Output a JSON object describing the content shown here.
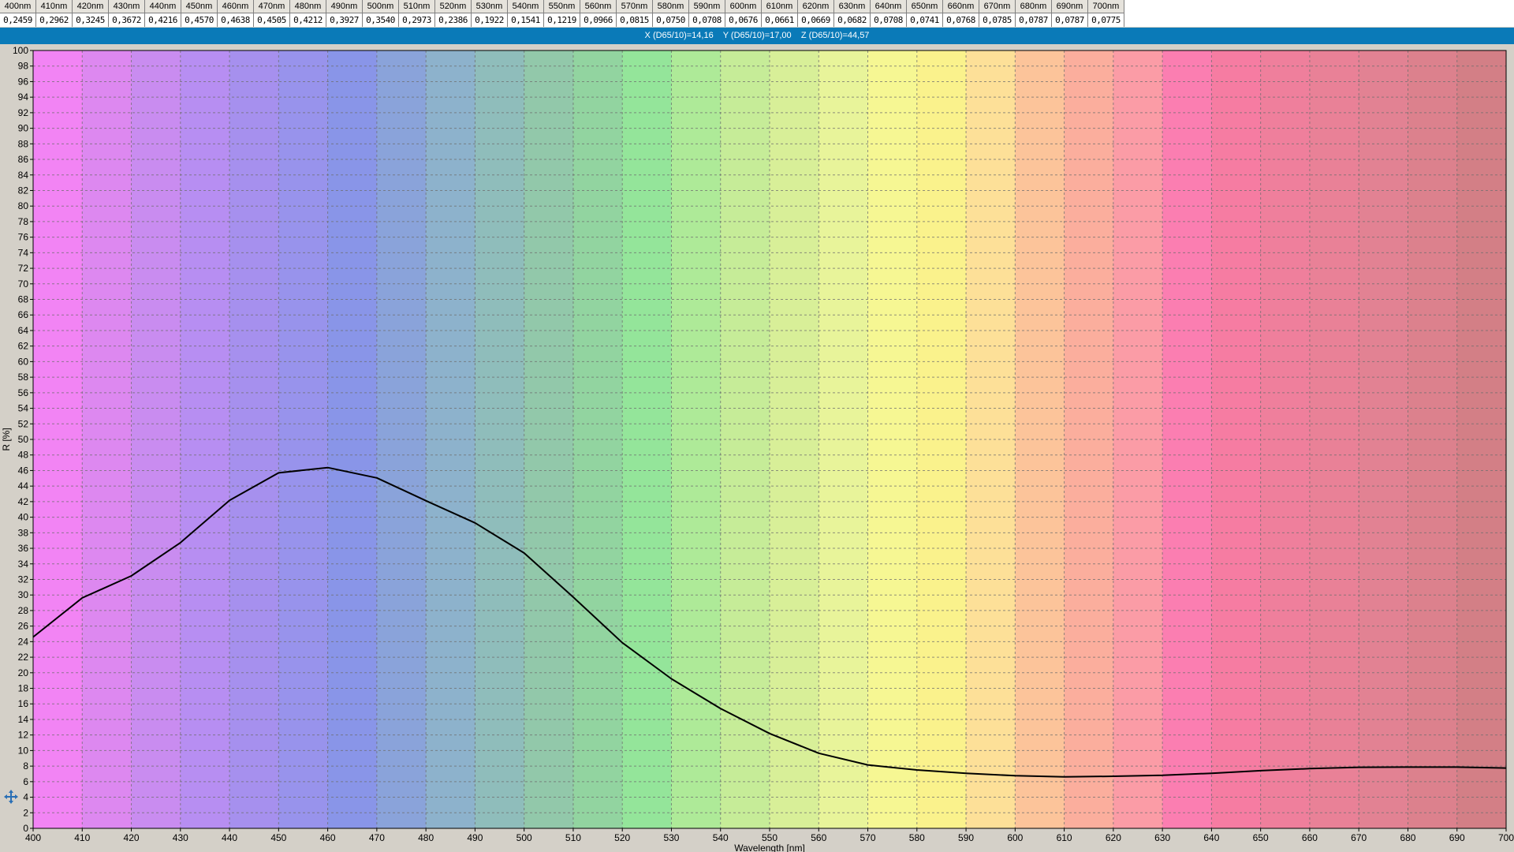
{
  "table": {
    "headers": [
      "400nm",
      "410nm",
      "420nm",
      "430nm",
      "440nm",
      "450nm",
      "460nm",
      "470nm",
      "480nm",
      "490nm",
      "500nm",
      "510nm",
      "520nm",
      "530nm",
      "540nm",
      "550nm",
      "560nm",
      "570nm",
      "580nm",
      "590nm",
      "600nm",
      "610nm",
      "620nm",
      "630nm",
      "640nm",
      "650nm",
      "660nm",
      "670nm",
      "680nm",
      "690nm",
      "700nm"
    ],
    "values": [
      "0,2459",
      "0,2962",
      "0,3245",
      "0,3672",
      "0,4216",
      "0,4570",
      "0,4638",
      "0,4505",
      "0,4212",
      "0,3927",
      "0,3540",
      "0,2973",
      "0,2386",
      "0,1922",
      "0,1541",
      "0,1219",
      "0,0966",
      "0,0815",
      "0,0750",
      "0,0708",
      "0,0676",
      "0,0661",
      "0,0669",
      "0,0682",
      "0,0708",
      "0,0741",
      "0,0768",
      "0,0785",
      "0,0787",
      "0,0787",
      "0,0775"
    ]
  },
  "xyz_bar": {
    "x": "X (D65/10)=14,16",
    "y": "Y (D65/10)=17,00",
    "z": "Z (D65/10)=44,57"
  },
  "nav_icon": "move-arrows-icon",
  "colors": {
    "bands": [
      "#f284f4",
      "#dd88f0",
      "#c98cf0",
      "#b78ef2",
      "#a690ee",
      "#9893ec",
      "#8995e8",
      "#8aa3da",
      "#8db2cc",
      "#8fbdbb",
      "#92c8aa",
      "#92d4a0",
      "#94e59a",
      "#aeea98",
      "#c6ec98",
      "#d8ef98",
      "#e8f49a",
      "#f6f793",
      "#faf28c",
      "#fde098",
      "#fcc49a",
      "#fbae9d",
      "#fb9ca6",
      "#fb7eb1",
      "#f67ca2",
      "#ef7f9c",
      "#e98197",
      "#e28293",
      "#dc818d",
      "#d37f86"
    ],
    "curve": "#000000",
    "grid": "#6e6e6e",
    "title_bar": "#0a7ab8"
  },
  "chart_data": {
    "type": "line",
    "title": "",
    "xlabel": "Wavelength [nm]",
    "ylabel": "R [%]",
    "xlim": [
      400,
      700
    ],
    "ylim": [
      0,
      100
    ],
    "x_ticks": [
      400,
      410,
      420,
      430,
      440,
      450,
      460,
      470,
      480,
      490,
      500,
      510,
      520,
      530,
      540,
      550,
      560,
      570,
      580,
      590,
      600,
      610,
      620,
      630,
      640,
      650,
      660,
      670,
      680,
      690,
      700
    ],
    "y_ticks": [
      0,
      2,
      4,
      6,
      8,
      10,
      12,
      14,
      16,
      18,
      20,
      22,
      24,
      26,
      28,
      30,
      32,
      34,
      36,
      38,
      40,
      42,
      44,
      46,
      48,
      50,
      52,
      54,
      56,
      58,
      60,
      62,
      64,
      66,
      68,
      70,
      72,
      74,
      76,
      78,
      80,
      82,
      84,
      86,
      88,
      90,
      92,
      94,
      96,
      98,
      100
    ],
    "grid": true,
    "series": [
      {
        "x": [
          400,
          410,
          420,
          430,
          440,
          450,
          460,
          470,
          480,
          490,
          500,
          510,
          520,
          530,
          540,
          550,
          560,
          570,
          580,
          590,
          600,
          610,
          620,
          630,
          640,
          650,
          660,
          670,
          680,
          690,
          700
        ],
        "values": [
          24.59,
          29.62,
          32.45,
          36.72,
          42.16,
          45.7,
          46.38,
          45.05,
          42.12,
          39.27,
          35.4,
          29.73,
          23.86,
          19.22,
          15.41,
          12.19,
          9.66,
          8.15,
          7.5,
          7.08,
          6.76,
          6.61,
          6.69,
          6.82,
          7.08,
          7.41,
          7.68,
          7.85,
          7.87,
          7.87,
          7.75
        ]
      }
    ]
  }
}
